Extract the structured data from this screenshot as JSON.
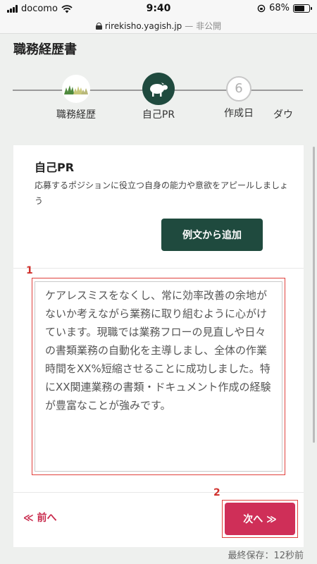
{
  "status": {
    "carrier": "docomo",
    "time": "9:40",
    "battery": "68%",
    "battery_level": 0.68
  },
  "url": {
    "domain": "rirekisho.yagish.jp",
    "suffix": "— 非公開"
  },
  "page": {
    "title": "職務経歴書"
  },
  "stepper": {
    "steps": [
      {
        "label": "職務経歴"
      },
      {
        "label": "自己PR"
      },
      {
        "label": "作成日",
        "number": "6"
      },
      {
        "label": "ダウ"
      }
    ]
  },
  "section": {
    "title": "自己PR",
    "description": "応募するポジションに役立つ自身の能力や意欲をアピールしましょう",
    "example_button": "例文から追加",
    "marker_1": "1",
    "body_text": "ケアレスミスをなくし、常に効率改善の余地がないか考えながら業務に取り組むように心がけています。現職では業務フローの見直しや日々の書類業務の自動化を主導しまし、全体の作業時間をXX%短縮させることに成功しました。特にXX関連業務の書類・ドキュメント作成の経験が豊富なことが強みです。"
  },
  "nav": {
    "prev_label": "≪ 前へ",
    "next_label": "次へ ≫",
    "marker_2": "2"
  },
  "footer": {
    "saved": "最終保存：12秒前"
  },
  "colors": {
    "primary": "#1f4a3e",
    "accent": "#cf2f58",
    "annotation": "#e0403c"
  }
}
